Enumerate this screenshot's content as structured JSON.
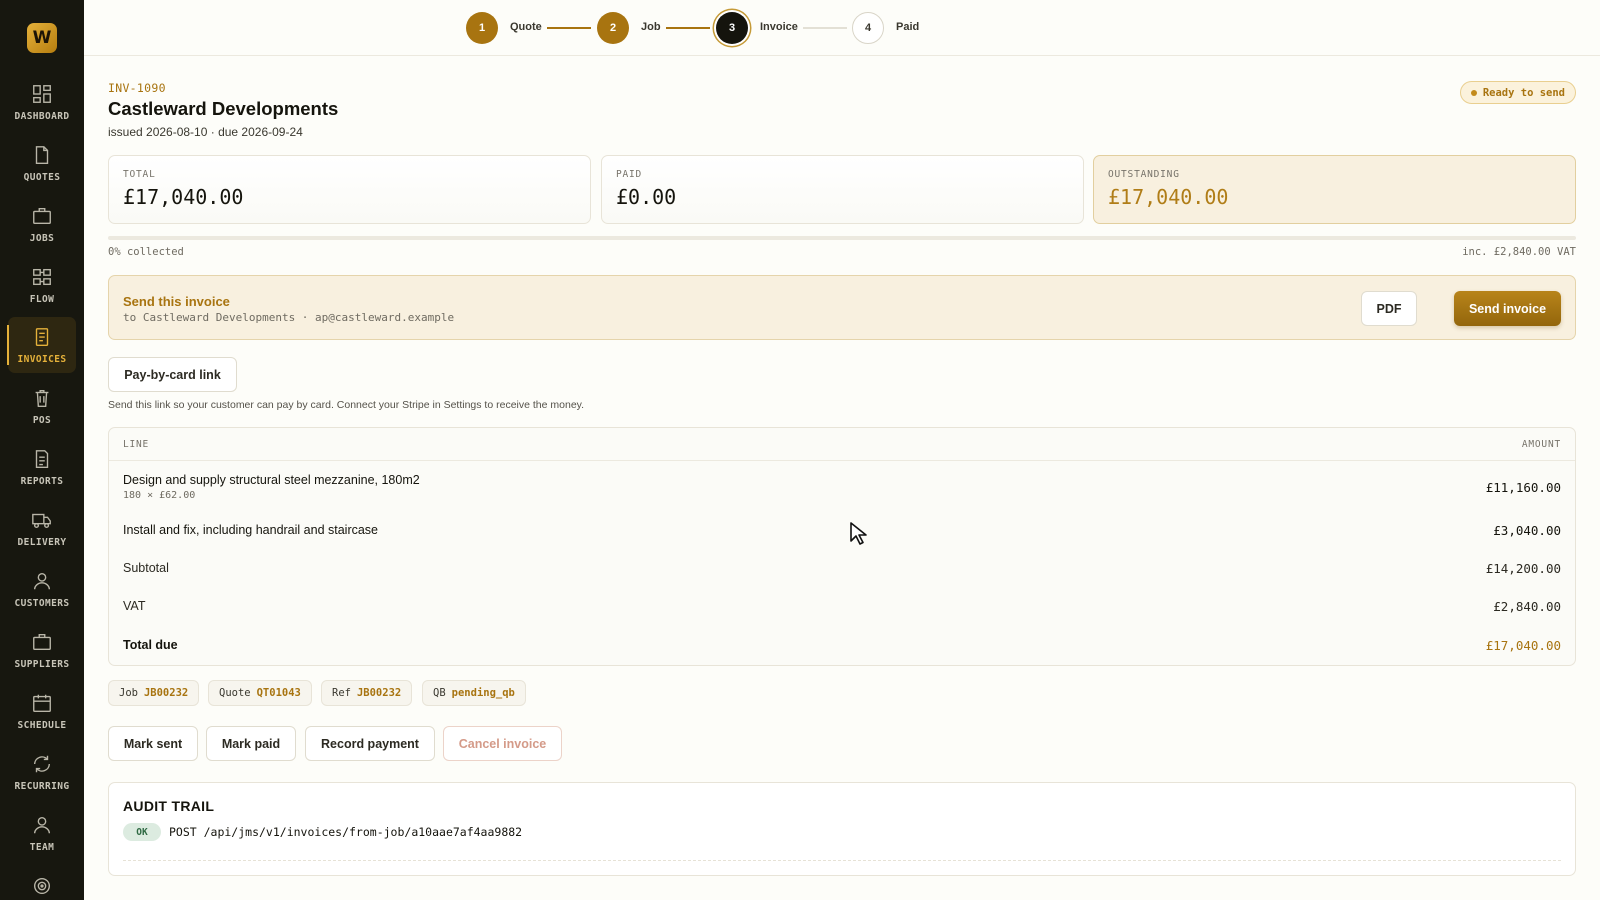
{
  "app": {
    "logo_letter": "W",
    "accent": "#a87410"
  },
  "sidebar": {
    "items": [
      {
        "label": "DASHBOARD",
        "icon": "dashboard-icon"
      },
      {
        "label": "QUOTES",
        "icon": "document-icon"
      },
      {
        "label": "JOBS",
        "icon": "briefcase-icon"
      },
      {
        "label": "FLOW",
        "icon": "flow-icon"
      },
      {
        "label": "INVOICES",
        "icon": "receipt-icon",
        "active": true
      },
      {
        "label": "POS",
        "icon": "trash-icon"
      },
      {
        "label": "REPORTS",
        "icon": "report-icon"
      },
      {
        "label": "DELIVERY",
        "icon": "truck-icon"
      },
      {
        "label": "CUSTOMERS",
        "icon": "user-icon"
      },
      {
        "label": "SUPPLIERS",
        "icon": "briefcase-icon"
      },
      {
        "label": "SCHEDULE",
        "icon": "calendar-icon"
      },
      {
        "label": "RECURRING",
        "icon": "refresh-icon"
      },
      {
        "label": "TEAM",
        "icon": "team-icon"
      },
      {
        "label": "",
        "icon": "target-icon"
      }
    ]
  },
  "stepper": {
    "steps": [
      {
        "num": "1",
        "label": "Quote",
        "state": "done"
      },
      {
        "num": "2",
        "label": "Job",
        "state": "done"
      },
      {
        "num": "3",
        "label": "Invoice",
        "state": "current"
      },
      {
        "num": "4",
        "label": "Paid",
        "state": "todo"
      }
    ]
  },
  "invoice": {
    "number": "INV-1090",
    "customer": "Castleward Developments",
    "dates": "issued 2026-08-10 · due 2026-09-24",
    "status": "Ready to send"
  },
  "stats": {
    "total_label": "TOTAL",
    "total_value": "£17,040.00",
    "paid_label": "PAID",
    "paid_value": "£0.00",
    "outstanding_label": "OUTSTANDING",
    "outstanding_value": "£17,040.00",
    "collected": "0% collected",
    "collected_fraction": 0,
    "inc_vat": "inc. £2,840.00 VAT"
  },
  "send_panel": {
    "title": "Send this invoice",
    "subtitle": "to Castleward Developments · ap@castleward.example",
    "pdf_label": "PDF",
    "send_label": "Send invoice"
  },
  "card_link": {
    "button_label": "Pay-by-card link",
    "note": "Send this link so your customer can pay by card. Connect your Stripe in Settings to receive the money."
  },
  "lines": {
    "col_line": "LINE",
    "col_amount": "AMOUNT",
    "items": [
      {
        "desc": "Design and supply structural steel mezzanine, 180m2",
        "sub": "180 × £62.00",
        "amount": "£11,160.00"
      },
      {
        "desc": "Install and fix, including handrail and staircase",
        "sub": "",
        "amount": "£3,040.00"
      }
    ],
    "subtotal_label": "Subtotal",
    "subtotal": "£14,200.00",
    "vat_label": "VAT",
    "vat": "£2,840.00",
    "total_label": "Total due",
    "total": "£17,040.00"
  },
  "refs": [
    {
      "key": "Job",
      "value": "JB00232"
    },
    {
      "key": "Quote",
      "value": "QT01043"
    },
    {
      "key": "Ref",
      "value": "JB00232"
    },
    {
      "key": "QB",
      "value": "pending_qb"
    }
  ],
  "actions": {
    "mark_sent": "Mark sent",
    "mark_paid": "Mark paid",
    "record_payment": "Record payment",
    "cancel": "Cancel invoice"
  },
  "audit": {
    "title": "AUDIT TRAIL",
    "entries": [
      {
        "status": "OK",
        "text": "POST /api/jms/v1/invoices/from-job/a10aae7af4aa9882"
      }
    ]
  }
}
